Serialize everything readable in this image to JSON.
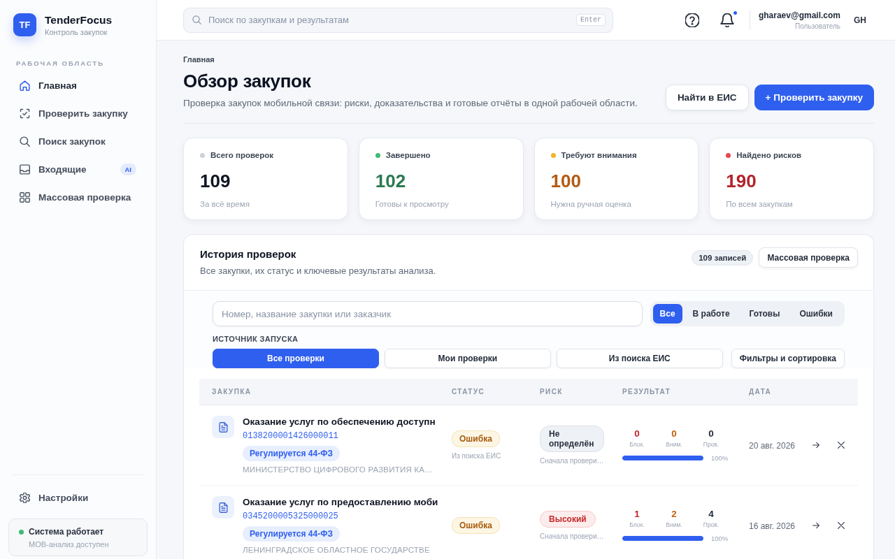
{
  "sidebar": {
    "logo": "TF",
    "brand": "TenderFocus",
    "tagline": "Контроль закупок",
    "section": "РАБОЧАЯ ОБЛАСТЬ",
    "items": [
      {
        "kind": "home",
        "label": "Главная",
        "selected": true
      },
      {
        "kind": "scan",
        "label": "Проверить закупку",
        "selected": false
      },
      {
        "kind": "search",
        "label": "Поиск закупок",
        "selected": false
      },
      {
        "kind": "inbox",
        "label": "Входящие",
        "selected": false,
        "badge": "AI"
      },
      {
        "kind": "grid",
        "label": "Массовая проверка",
        "selected": false
      }
    ],
    "settings": {
      "label": "Настройки"
    },
    "system_status": {
      "online": true,
      "title": "Система работает",
      "detail": "MOB-анализ доступен"
    }
  },
  "topbar": {
    "search": {
      "placeholder": "Поиск по закупкам и результатам",
      "shortcut": "Enter"
    },
    "notifications": {
      "unread": true
    },
    "user": {
      "email": "gharaev@gmail.com",
      "role": "Пользователь",
      "initials": "GH"
    }
  },
  "page": {
    "breadcrumb": "Главная",
    "title": "Обзор закупок",
    "subtitle": "Проверка закупок мобильной связи: риски, доказательства и готовые отчёты в одной рабочей области.",
    "actions": [
      {
        "kind": "secondary",
        "label": "Найти в ЕИС"
      },
      {
        "kind": "primary",
        "label": "+ Проверить закупку"
      }
    ]
  },
  "stats": [
    {
      "kind": "total",
      "color": "#cbd2dc",
      "label": "Всего проверок",
      "value": "109",
      "caption": "За всё время"
    },
    {
      "kind": "done",
      "color": "#3dbb74",
      "label": "Завершено",
      "value": "102",
      "caption": "Готовы к просмотру"
    },
    {
      "kind": "attention",
      "color": "#f0b429",
      "label": "Требуют внимания",
      "value": "100",
      "caption": "Нужна ручная оценка"
    },
    {
      "kind": "risk",
      "color": "#e5484d",
      "label": "Найдено рисков",
      "value": "190",
      "caption": "По всем закупкам"
    }
  ],
  "history": {
    "title": "История проверок",
    "subtitle": "Все закупки, их статус и ключевые результаты анализа.",
    "count": "109 записей",
    "bulk_button": "Массовая проверка",
    "search": {
      "placeholder": "Номер, название закупки или заказчик"
    },
    "status_filters": [
      {
        "label": "Все",
        "selected": true
      },
      {
        "label": "В работе",
        "selected": false
      },
      {
        "label": "Готовы",
        "selected": false
      },
      {
        "label": "Ошибки",
        "selected": false
      }
    ],
    "source_label": "ИСТОЧНИК ЗАПУСКА",
    "sources": [
      {
        "label": "Все проверки",
        "selected": true
      },
      {
        "label": "Мои проверки",
        "selected": false
      },
      {
        "label": "Из поиска ЕИС",
        "selected": false
      }
    ],
    "filters_button": "Фильтры и сортировка",
    "columns": [
      "ЗАКУПКА",
      "СТАТУС",
      "РИСК",
      "РЕЗУЛЬТАТ",
      "ДАТА"
    ],
    "rows": [
      {
        "title": "Оказание услуг по обеспечению доступн",
        "number": "0138200001426000011",
        "regulation": "Регулируется 44-ФЗ",
        "customer": "МИНИСТЕРСТВО ЦИФРОВОГО РАЗВИТИЯ КА…",
        "status": {
          "kind": "error",
          "label": "Ошибка",
          "source": "Из поиска ЕИС"
        },
        "risk": {
          "kind": "unknown",
          "label": "Не определён",
          "note": "Сначала провери…"
        },
        "result": {
          "counters": [
            {
              "kind": "blocked",
              "value": "0",
              "label": "Блок."
            },
            {
              "kind": "attention",
              "value": "0",
              "label": "Вним."
            },
            {
              "kind": "checked",
              "value": "0",
              "label": "Пров."
            }
          ],
          "level": 1,
          "reading": "100%"
        },
        "date": "20 авг. 2026"
      },
      {
        "title": "Оказание услуг по предоставлению моби",
        "number": "0345200005325000025",
        "regulation": "Регулируется 44-ФЗ",
        "customer": "ЛЕНИНГРАДСКОЕ ОБЛАСТНОЕ ГОСУДАРСТВЕ",
        "status": {
          "kind": "error",
          "label": "Ошибка"
        },
        "risk": {
          "kind": "high",
          "label": "Высокий",
          "note": "Сначала провери…"
        },
        "result": {
          "counters": [
            {
              "kind": "blocked",
              "value": "1",
              "label": "Блок."
            },
            {
              "kind": "attention",
              "value": "2",
              "label": "Вним."
            },
            {
              "kind": "checked",
              "value": "4",
              "label": "Пров."
            }
          ],
          "level": 1,
          "reading": "100%"
        },
        "date": "16 авг. 2026"
      }
    ]
  }
}
